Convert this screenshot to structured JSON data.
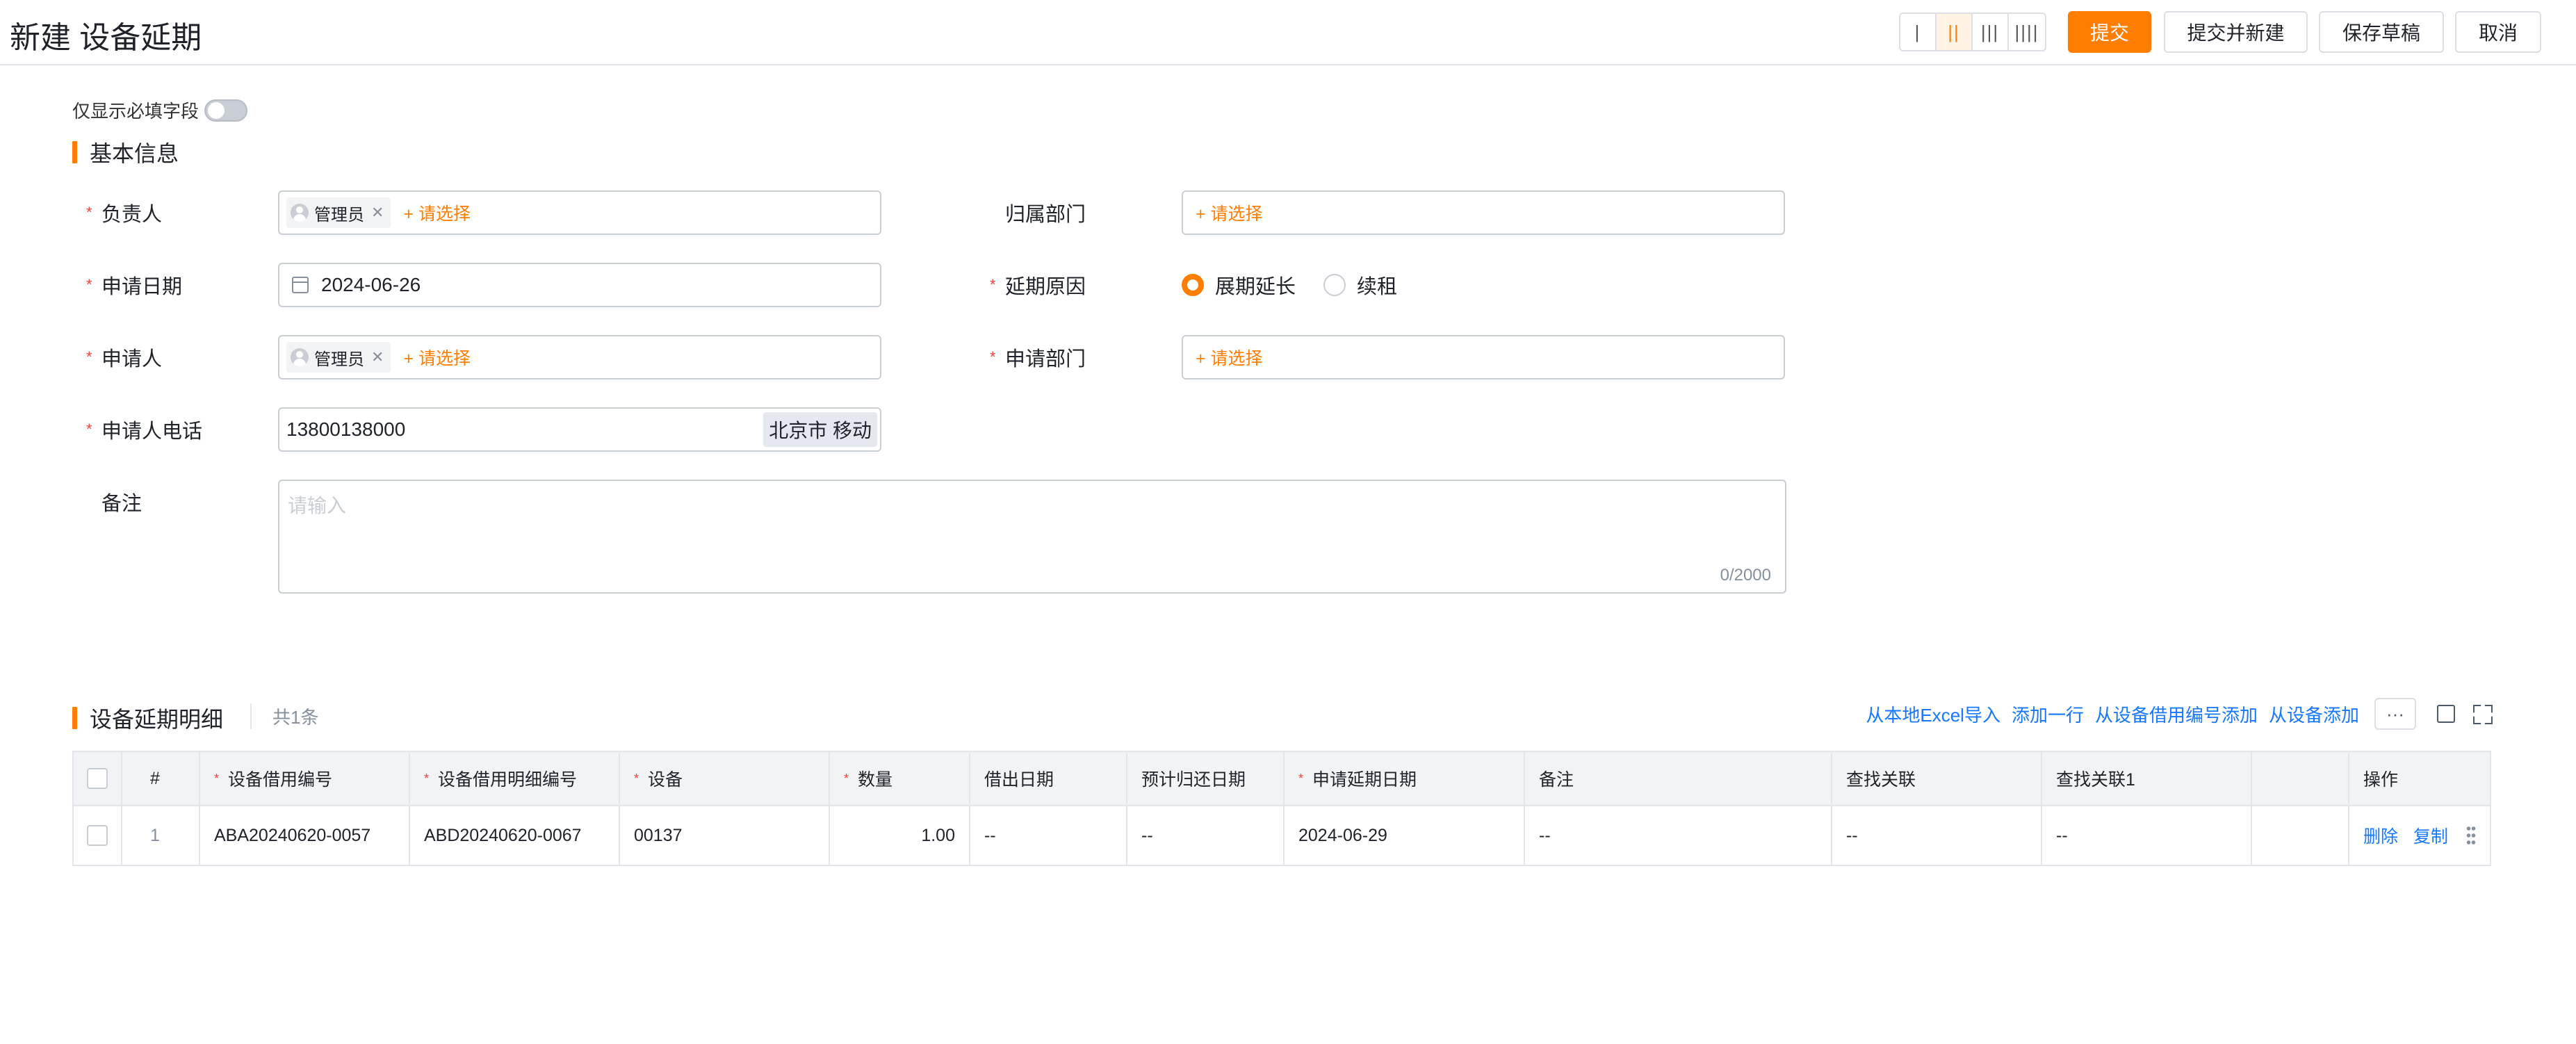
{
  "header": {
    "title": "新建 设备延期",
    "layout_options": [
      "|",
      "||",
      "|||",
      "||||"
    ],
    "active_layout": 1,
    "buttons": {
      "submit": "提交",
      "submit_new": "提交并新建",
      "save_draft": "保存草稿",
      "cancel": "取消"
    }
  },
  "toggle": {
    "label": "仅显示必填字段",
    "on": false
  },
  "basic": {
    "title": "基本信息",
    "owner": {
      "label": "负责人",
      "tag": "管理员",
      "pick": "+ 请选择"
    },
    "dept": {
      "label": "归属部门",
      "pick": "+ 请选择"
    },
    "apply_date": {
      "label": "申请日期",
      "value": "2024-06-26"
    },
    "reason": {
      "label": "延期原因",
      "options": [
        "展期延长",
        "续租"
      ],
      "selected": "展期延长"
    },
    "applicant": {
      "label": "申请人",
      "tag": "管理员",
      "pick": "+ 请选择"
    },
    "apply_dept": {
      "label": "申请部门",
      "pick": "+ 请选择"
    },
    "phone": {
      "label": "申请人电话",
      "value": "13800138000",
      "carrier": "北京市 移动"
    },
    "memo": {
      "label": "备注",
      "placeholder": "请输入",
      "counter": "0/2000"
    }
  },
  "detail": {
    "title": "设备延期明细",
    "count": "共1条",
    "actions": [
      "从本地Excel导入",
      "添加一行",
      "从设备借用编号添加",
      "从设备添加"
    ],
    "more": "···",
    "columns": {
      "idx": "#",
      "borrow_no": "设备借用编号",
      "detail_no": "设备借用明细编号",
      "device": "设备",
      "qty": "数量",
      "out_date": "借出日期",
      "return_date": "预计归还日期",
      "extend_date": "申请延期日期",
      "memo": "备注",
      "find1": "查找关联",
      "find2": "查找关联1",
      "ops": "操作"
    },
    "rows": [
      {
        "idx": "1",
        "borrow_no": "ABA20240620-0057",
        "detail_no": "ABD20240620-0067",
        "device": "00137",
        "qty": "1.00",
        "out_date": "--",
        "return_date": "--",
        "extend_date": "2024-06-29",
        "memo": "--",
        "find1": "--",
        "find2": "--",
        "delete": "删除",
        "copy": "复制"
      }
    ]
  },
  "colors": {
    "accent": "#ff7d00",
    "link": "#1677ff",
    "required": "#f53f3f"
  }
}
